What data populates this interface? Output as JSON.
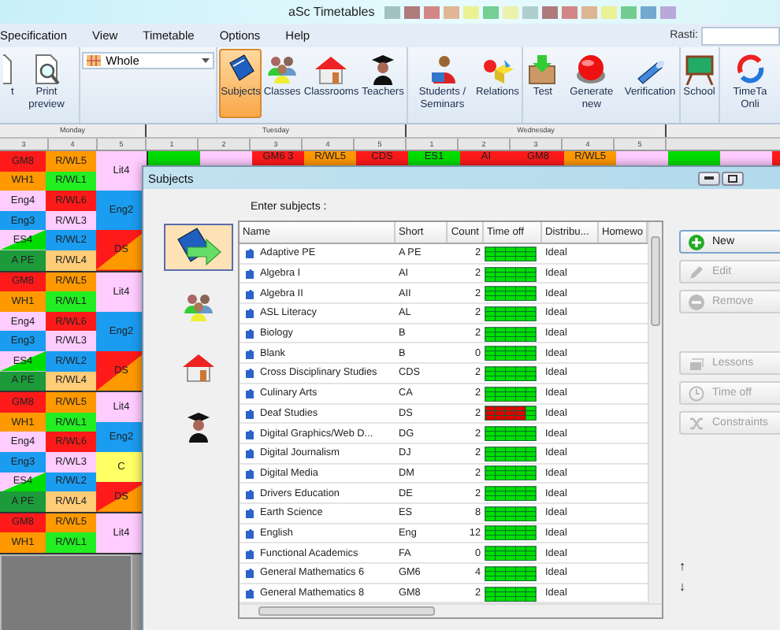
{
  "window": {
    "title": "aSc Timetables"
  },
  "menu": {
    "items": [
      "Specification",
      "View",
      "Timetable",
      "Options",
      "Help"
    ],
    "search_label": "Rasti:"
  },
  "toolbar": {
    "groups": [
      [
        {
          "kind": "print",
          "label": "t"
        },
        {
          "kind": "preview",
          "label": "Print preview"
        }
      ],
      [
        {
          "kind": "dropdown",
          "label": "Whole"
        }
      ],
      [
        {
          "kind": "subjects",
          "label": "Subjects",
          "selected": true
        },
        {
          "kind": "classes",
          "label": "Classes",
          "selected": false
        },
        {
          "kind": "classrooms",
          "label": "Classrooms",
          "selected": false
        },
        {
          "kind": "teachers",
          "label": "Teachers",
          "selected": false
        }
      ],
      [
        {
          "kind": "students",
          "label": "Students / Seminars"
        },
        {
          "kind": "relations",
          "label": "Relations"
        }
      ],
      [
        {
          "kind": "test",
          "label": "Test"
        },
        {
          "kind": "generate",
          "label": "Generate new"
        },
        {
          "kind": "verification",
          "label": "Verification"
        }
      ],
      [
        {
          "kind": "school",
          "label": "School"
        }
      ],
      [
        {
          "kind": "online",
          "label": "TimeTa Onli"
        }
      ]
    ]
  },
  "timetable": {
    "days": [
      {
        "name": "Monday",
        "periods": [
          "3",
          "4",
          "5"
        ]
      },
      {
        "name": "Tuesday",
        "periods": [
          "1",
          "2",
          "3",
          "4",
          "5"
        ]
      },
      {
        "name": "Wednesday",
        "periods": [
          "1",
          "2",
          "3",
          "4",
          "5"
        ]
      }
    ],
    "top_row": [
      {
        "color": "#00dd00"
      },
      {
        "color": "#ffccff"
      },
      {
        "text": "GM6 3",
        "color": "#ff1a1a"
      },
      {
        "text": "R/WL5",
        "color": "#ff9900"
      },
      {
        "text": "CDS",
        "color": "#ff1a1a"
      },
      {
        "text": "ES1",
        "color": "#00dd00"
      },
      {
        "text": "AI",
        "color": "#ff1a1a"
      },
      {
        "text": "GM8",
        "color": "#ff1a1a"
      },
      {
        "text": "R/WL5",
        "color": "#ff9900"
      },
      {
        "color": "#ffccff"
      },
      {
        "color": "#00dd00"
      },
      {
        "color": "#ffccff"
      },
      {
        "color": "#ff1a1a"
      }
    ],
    "monday_groups": [
      {
        "columns": [
          [
            {
              "text": "GM8",
              "color": "#ff1a1a"
            },
            {
              "text": "WH1",
              "color": "#ff9900"
            },
            {
              "text": "Eng4",
              "color": "#ffccff"
            },
            {
              "text": "Eng3",
              "color": "#1a9cf0"
            },
            {
              "text": "ES4",
              "color": "#ffccff",
              "corner": {
                "color": "#00dd00"
              }
            },
            {
              "text": "A PE",
              "color": "#1d9a3a"
            }
          ],
          [
            {
              "text": "R/WL5",
              "color": "#ff9900"
            },
            {
              "text": "R/WL1",
              "color": "#22ee22"
            },
            {
              "text": "R/WL6",
              "color": "#ff1a1a"
            },
            {
              "text": "R/WL3",
              "color": "#ffccff"
            },
            {
              "text": "R/WL2",
              "color": "#1a9cf0"
            },
            {
              "text": "R/WL4",
              "color": "#ffcc77"
            }
          ],
          [
            {
              "text": "Lit4",
              "color": "#ffccff"
            },
            {
              "text": "Eng2",
              "color": "#1a9cf0"
            },
            {
              "text": "DS",
              "color": "#ff1a1a",
              "corner": {
                "color": "#ff9900"
              }
            }
          ]
        ]
      },
      {
        "columns": [
          [
            {
              "text": "GM8",
              "color": "#ff1a1a"
            },
            {
              "text": "WH1",
              "color": "#ff9900"
            },
            {
              "text": "Eng4",
              "color": "#ffccff"
            },
            {
              "text": "Eng3",
              "color": "#1a9cf0"
            },
            {
              "text": "ES4",
              "color": "#ffccff",
              "corner": {
                "color": "#00dd00"
              }
            },
            {
              "text": "A PE",
              "color": "#1d9a3a"
            }
          ],
          [
            {
              "text": "R/WL5",
              "color": "#ff9900"
            },
            {
              "text": "R/WL1",
              "color": "#22ee22"
            },
            {
              "text": "R/WL6",
              "color": "#ff1a1a"
            },
            {
              "text": "R/WL3",
              "color": "#ffccff"
            },
            {
              "text": "R/WL2",
              "color": "#1a9cf0"
            },
            {
              "text": "R/WL4",
              "color": "#ffcc77"
            }
          ],
          [
            {
              "text": "Lit4",
              "color": "#ffccff"
            },
            {
              "text": "Eng2",
              "color": "#1a9cf0"
            },
            {
              "text": "DS",
              "color": "#ff1a1a",
              "corner": {
                "color": "#ff9900"
              }
            }
          ]
        ]
      },
      {
        "columns": [
          [
            {
              "text": "GM8",
              "color": "#ff1a1a"
            },
            {
              "text": "WH1",
              "color": "#ff9900"
            },
            {
              "text": "Eng4",
              "color": "#ffccff"
            },
            {
              "text": "Eng3",
              "color": "#1a9cf0"
            },
            {
              "text": "ES4",
              "color": "#ffccff",
              "corner": {
                "color": "#00dd00"
              }
            },
            {
              "text": "A PE",
              "color": "#1d9a3a"
            }
          ],
          [
            {
              "text": "R/WL5",
              "color": "#ff9900"
            },
            {
              "text": "R/WL1",
              "color": "#22ee22"
            },
            {
              "text": "R/WL6",
              "color": "#ff1a1a"
            },
            {
              "text": "R/WL3",
              "color": "#ffccff"
            },
            {
              "text": "R/WL2",
              "color": "#1a9cf0"
            },
            {
              "text": "R/WL4",
              "color": "#ffcc77"
            }
          ],
          [
            {
              "text": "Lit4",
              "color": "#ffccff"
            },
            {
              "text": "Eng2",
              "color": "#1a9cf0"
            },
            {
              "text": "C",
              "color": "#ffff66"
            },
            {
              "text": "DS",
              "color": "#ff1a1a",
              "corner": {
                "color": "#ff9900"
              }
            }
          ]
        ]
      },
      {
        "columns": [
          [
            {
              "text": "GM8",
              "color": "#ff1a1a"
            },
            {
              "text": "WH1",
              "color": "#ff9900"
            }
          ],
          [
            {
              "text": "R/WL5",
              "color": "#ff9900"
            },
            {
              "text": "R/WL1",
              "color": "#22ee22"
            }
          ],
          [
            {
              "text": "Lit4",
              "color": "#ffccff"
            }
          ]
        ]
      }
    ]
  },
  "dialog": {
    "title": "Subjects",
    "nav": [
      {
        "kind": "subjects",
        "selected": true
      },
      {
        "kind": "classes",
        "selected": false
      },
      {
        "kind": "classrooms",
        "selected": false
      },
      {
        "kind": "teachers",
        "selected": false
      }
    ],
    "prompt": "Enter subjects :",
    "table": {
      "columns": [
        "Name",
        "Short",
        "Count",
        "Time off",
        "Distribu...",
        "Homewo"
      ],
      "rows": [
        {
          "name": "Adaptive PE",
          "short": "A PE",
          "count": "2",
          "restricted": false,
          "distribution": "Ideal"
        },
        {
          "name": "Algebra I",
          "short": "AI",
          "count": "2",
          "restricted": false,
          "distribution": "Ideal"
        },
        {
          "name": "Algebra II",
          "short": "AII",
          "count": "2",
          "restricted": false,
          "distribution": "Ideal"
        },
        {
          "name": "ASL Literacy",
          "short": "AL",
          "count": "2",
          "restricted": false,
          "distribution": "Ideal"
        },
        {
          "name": "Biology",
          "short": "B",
          "count": "2",
          "restricted": false,
          "distribution": "Ideal"
        },
        {
          "name": "Blank",
          "short": "B",
          "count": "0",
          "restricted": false,
          "distribution": "Ideal"
        },
        {
          "name": "Cross Disciplinary Studies",
          "short": "CDS",
          "count": "2",
          "restricted": false,
          "distribution": "Ideal"
        },
        {
          "name": "Culinary Arts",
          "short": "CA",
          "count": "2",
          "restricted": false,
          "distribution": "Ideal"
        },
        {
          "name": "Deaf Studies",
          "short": "DS",
          "count": "2",
          "restricted": true,
          "distribution": "Ideal"
        },
        {
          "name": "Digital Graphics/Web D...",
          "short": "DG",
          "count": "2",
          "restricted": false,
          "distribution": "Ideal"
        },
        {
          "name": "Digital Journalism",
          "short": "DJ",
          "count": "2",
          "restricted": false,
          "distribution": "Ideal"
        },
        {
          "name": "Digital Media",
          "short": "DM",
          "count": "2",
          "restricted": false,
          "distribution": "Ideal"
        },
        {
          "name": "Drivers Education",
          "short": "DE",
          "count": "2",
          "restricted": false,
          "distribution": "Ideal"
        },
        {
          "name": "Earth Science",
          "short": "ES",
          "count": "8",
          "restricted": false,
          "distribution": "Ideal"
        },
        {
          "name": "English",
          "short": "Eng",
          "count": "12",
          "restricted": false,
          "distribution": "Ideal"
        },
        {
          "name": "Functional Academics",
          "short": "FA",
          "count": "0",
          "restricted": false,
          "distribution": "Ideal"
        },
        {
          "name": "General Mathematics 6",
          "short": "GM6",
          "count": "4",
          "restricted": false,
          "distribution": "Ideal"
        },
        {
          "name": "General Mathematics 8",
          "short": "GM8",
          "count": "2",
          "restricted": false,
          "distribution": "Ideal"
        }
      ]
    },
    "button_groups": [
      [
        {
          "kind": "new",
          "label": "New",
          "disabled": false
        },
        {
          "kind": "edit",
          "label": "Edit",
          "disabled": true
        },
        {
          "kind": "remove",
          "label": "Remove",
          "disabled": true
        }
      ],
      [
        {
          "kind": "lessons",
          "label": "Lessons",
          "disabled": true
        },
        {
          "kind": "timeoff",
          "label": "Time off",
          "disabled": true
        },
        {
          "kind": "constraints",
          "label": "Constraints",
          "disabled": true
        }
      ]
    ],
    "move_buttons": [
      "↑",
      "↓"
    ]
  }
}
